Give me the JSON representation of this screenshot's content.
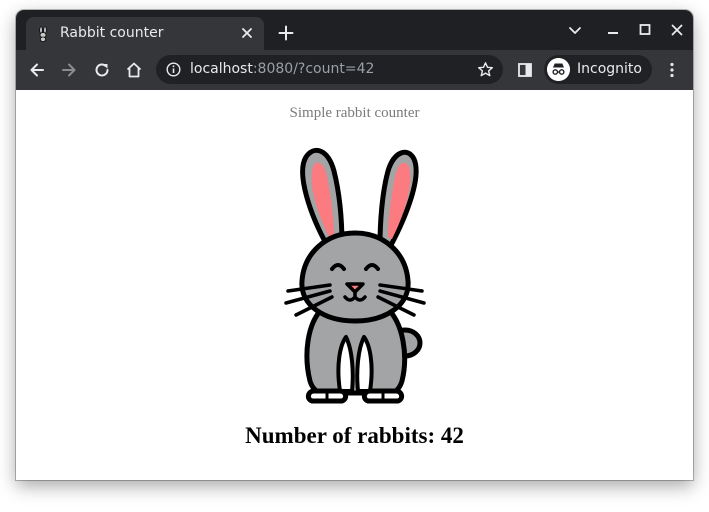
{
  "browser": {
    "tab_title": "Rabbit counter",
    "url_host": "localhost",
    "url_rest": ":8080/?count=42",
    "profile_label": "Incognito",
    "theme": {
      "frame": "#1f2023",
      "toolbar": "#35363a",
      "omnibox": "#202124",
      "text": "#e8eaed"
    }
  },
  "icons": {
    "tab_favicon": "rabbit-icon",
    "tab_close": "close-icon",
    "new_tab": "plus-icon",
    "tab_search": "chevron-down-icon",
    "minimize": "minimize-icon",
    "maximize": "maximize-icon",
    "close_window": "close-icon",
    "back": "arrow-left-icon",
    "forward": "arrow-right-icon",
    "reload": "reload-icon",
    "home": "home-icon",
    "site_info": "info-icon",
    "bookmark": "star-icon",
    "side_panel": "side-panel-icon",
    "incognito": "incognito-icon",
    "menu": "kebab-menu-icon"
  },
  "page": {
    "subtitle": "Simple rabbit counter",
    "counter_text": "Number of rabbits: 42",
    "image_icon": "rabbit-icon"
  },
  "colors": {
    "rabbit_body": "#a2a4a6",
    "rabbit_ear_inner": "#fc7b80",
    "rabbit_belly": "#ffffff",
    "outline": "#000000"
  }
}
